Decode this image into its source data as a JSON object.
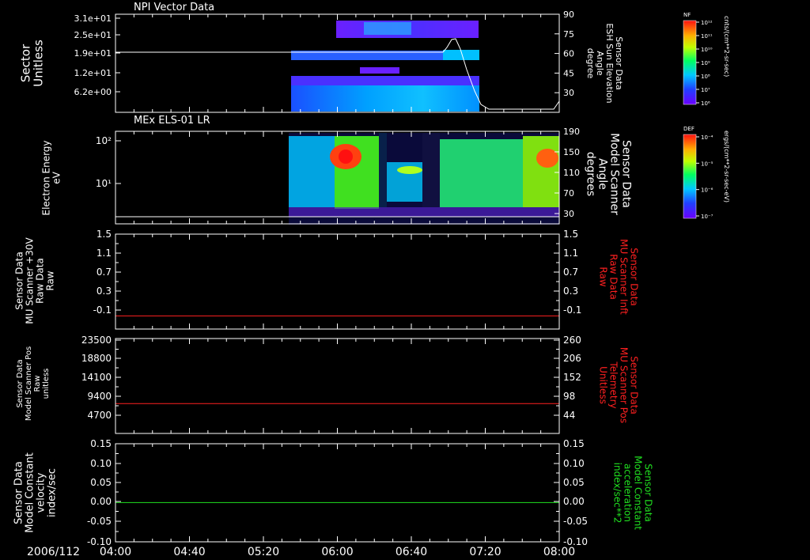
{
  "figure_date": "2006/112",
  "time_axis": {
    "tick_labels": [
      "04:00",
      "04:40",
      "05:20",
      "06:00",
      "06:40",
      "07:20",
      "08:00"
    ],
    "tick_times": [
      "04:00",
      "04:40",
      "05:20",
      "06:00",
      "06:40",
      "07:20",
      "08:00"
    ]
  },
  "chart_data": [
    {
      "type": "heatmap",
      "title": "NPI Vector Data",
      "ylabel": [
        "Sector",
        "Unitless"
      ],
      "left_tick_labels": [
        "3.1e+01",
        "2.5e+01",
        "1.9e+01",
        "1.2e+01",
        "6.2e+00"
      ],
      "ylabel_right": [
        "Sensor Data",
        "ESH Sun Elevation",
        "Angle",
        "degree"
      ],
      "right_ticks": [
        30,
        45,
        60,
        75,
        90
      ],
      "right_ylim": [
        15,
        90
      ],
      "overlay_line_color": "#ffffff",
      "colorbar": {
        "title": "NF",
        "unit_label": "cnts/(cm**2-sr-sec)",
        "tick_labels": [
          "10¹²",
          "10¹¹",
          "10¹⁰",
          "10⁹",
          "10⁸",
          "10⁷",
          "10⁶"
        ],
        "scale": "log"
      }
    },
    {
      "type": "heatmap",
      "title": "MEx ELS-01 LR",
      "ylabel": [
        "Electron Energy",
        "eV"
      ],
      "left_tick_labels": [
        "10²",
        "10¹"
      ],
      "ylabel_right": [
        "Sensor Data",
        "Model Scanner",
        "Angle",
        "degrees"
      ],
      "right_ticks": [
        30,
        70,
        110,
        150,
        190
      ],
      "right_ylim": [
        10,
        190
      ],
      "overlay_line_color": "#ffffff",
      "colorbar": {
        "title": "DEF",
        "unit_label": "ergs/(cm**2-sr-sec-eV)",
        "tick_labels": [
          "10⁻⁴",
          "10⁻⁵",
          "10⁻⁶",
          "10⁻⁷"
        ],
        "scale": "log"
      }
    },
    {
      "type": "line",
      "ylabel": [
        "Sensor Data",
        "MU Scanner +30V",
        "Raw Data",
        "Raw"
      ],
      "ylabel_right": [
        "Sensor Data",
        "MU Scanner Inft",
        "Raw Data",
        "Raw"
      ],
      "left_tick_labels": [
        "1.5",
        "1.1",
        "0.7",
        "0.3",
        "-0.1"
      ],
      "right_tick_labels": [
        "1.5",
        "1.1",
        "0.7",
        "0.3",
        "-0.1"
      ],
      "ylim": [
        -0.3,
        1.5
      ],
      "series": [
        {
          "color": "#ff2020",
          "x": [
            "04:00",
            "08:00"
          ],
          "y": [
            -0.05,
            -0.05
          ]
        }
      ]
    },
    {
      "type": "line",
      "ylabel": [
        "Sensor Data",
        "Model Scanner Pos",
        "Raw",
        "unitless"
      ],
      "ylabel_right": [
        "Sensor Data",
        "MU Scanner Pos",
        "Telemetry",
        "Unitless"
      ],
      "left_tick_labels": [
        "23500",
        "18800",
        "14100",
        "9400",
        "4700"
      ],
      "right_tick_labels": [
        "260",
        "206",
        "152",
        "98",
        "44"
      ],
      "ylim": [
        0,
        23500
      ],
      "series": [
        {
          "color": "#ff2020",
          "x": [
            "04:00",
            "08:00"
          ],
          "y": [
            7400,
            7400
          ]
        }
      ]
    },
    {
      "type": "line",
      "ylabel": [
        "Sensor Data",
        "Model Constant",
        "velocity",
        "index/sec"
      ],
      "ylabel_right": [
        "Sensor Data",
        "Model Constant",
        "acceleration",
        "index/sec**2"
      ],
      "left_tick_labels": [
        "0.15",
        "0.10",
        "0.05",
        "0.00",
        "-0.05",
        "-0.10"
      ],
      "right_tick_labels": [
        "0.15",
        "0.10",
        "0.05",
        "0.00",
        "-0.05",
        "-0.10"
      ],
      "ylim": [
        -0.1,
        0.15
      ],
      "series": [
        {
          "color": "#20e020",
          "x": [
            "04:00",
            "08:00"
          ],
          "y": [
            0,
            0
          ]
        }
      ]
    }
  ],
  "colors": {
    "background": "#000000",
    "axis": "#ffffff",
    "right_label_panel3": "#ff2020",
    "right_label_panel4": "#ff2020",
    "right_label_panel5": "#20e020"
  }
}
